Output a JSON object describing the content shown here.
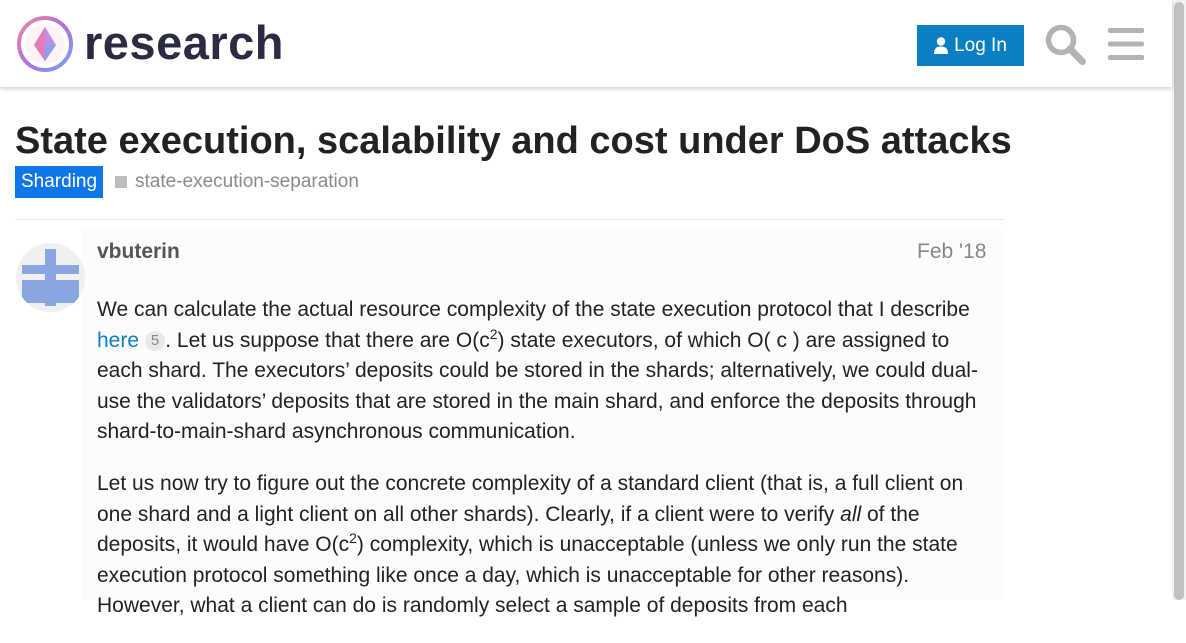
{
  "brand": {
    "name": "research"
  },
  "header": {
    "login_label": "Log In",
    "search_icon": "search-icon",
    "menu_icon": "hamburger-menu-icon"
  },
  "topic": {
    "title": "State execution, scalability and cost under DoS attacks",
    "category": "Sharding",
    "tag": "state-execution-separation"
  },
  "colors": {
    "login_button": "#0a7fc2",
    "category_badge": "#0e76e8",
    "link": "#0a7fc2"
  },
  "post": {
    "author": "vbuterin",
    "date": "Feb '18",
    "p1": {
      "t1": "We can calculate the actual resource complexity of the state execution protocol that I describe ",
      "link": "here",
      "link_count": "5",
      "t2": ". Let us suppose that there are O(c",
      "sup": "2",
      "t3": ") state executors, of which O( c ) are assigned to each shard. The executors’ deposits could be stored in the shards; alternatively, we could dual-use the validators’ deposits that are stored in the main shard, and enforce the deposits through shard-to-main-shard asynchronous communication."
    },
    "p2": {
      "t1": "Let us now try to figure out the concrete complexity of a standard client (that is, a full client on one shard and a light client on all other shards). Clearly, if a client were to verify ",
      "em": "all",
      "t2": " of the deposits, it would have O(c",
      "sup": "2",
      "t3": ") complexity, which is unacceptable (unless we only run the state execution protocol something like once a day, which is unacceptable for other reasons). However, what a client can do is randomly select a sample of deposits from each"
    }
  }
}
